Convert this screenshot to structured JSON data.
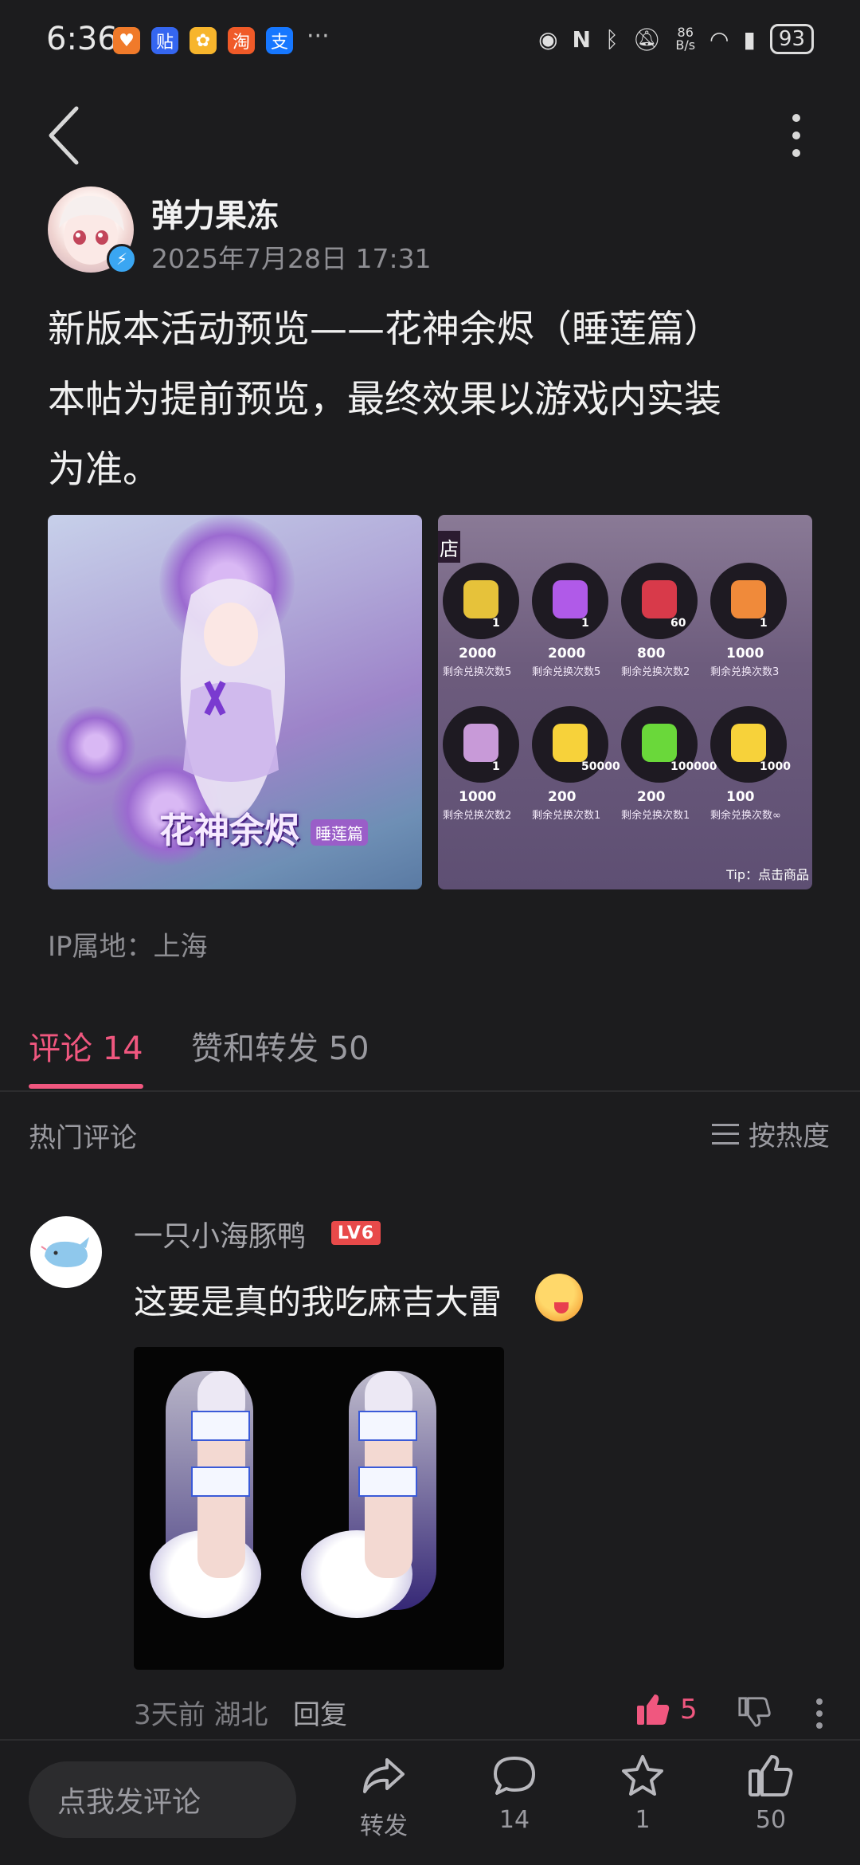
{
  "status_bar": {
    "time": "6:36",
    "apps": [
      {
        "name": "health-app-icon",
        "glyph": "♥",
        "color": "#f07a2a"
      },
      {
        "name": "tieba-app-icon",
        "glyph": "贴",
        "color": "#3566f0"
      },
      {
        "name": "flower-app-icon",
        "glyph": "✿",
        "color": "#f7b52c"
      },
      {
        "name": "taobao-app-icon",
        "glyph": "淘",
        "color": "#f05a28"
      },
      {
        "name": "alipay-app-icon",
        "glyph": "支",
        "color": "#1677ff"
      }
    ],
    "more": "···",
    "net_speed_value": "86",
    "net_speed_unit": "B/s",
    "battery": "93"
  },
  "post": {
    "author": "弹力果冻",
    "time": "2025年7月28日 17:31",
    "content_lines": [
      "新版本活动预览——花神余烬（睡莲篇）",
      "本帖为提前预览，最终效果以游戏内实装",
      "为准。"
    ],
    "banner_title": "花神余烬",
    "banner_subtitle": "睡莲篇",
    "ip_location": "IP属地：上海"
  },
  "shop": {
    "tag": "店",
    "items": [
      {
        "qty": "1",
        "price": "2000",
        "note": "剩余兑换次数5",
        "color": "#e6c23a"
      },
      {
        "qty": "1",
        "price": "2000",
        "note": "剩余兑换次数5",
        "color": "#b05ae8"
      },
      {
        "qty": "60",
        "price": "800",
        "note": "剩余兑换次数2",
        "color": "#d83a4a"
      },
      {
        "qty": "1",
        "price": "1000",
        "note": "剩余兑换次数3",
        "color": "#f08a3a"
      },
      {
        "qty": "1",
        "price": "1000",
        "note": "剩余兑换次数2",
        "color": "#c89ad8"
      },
      {
        "qty": "50000",
        "price": "200",
        "note": "剩余兑换次数1",
        "color": "#f7d23a"
      },
      {
        "qty": "100000",
        "price": "200",
        "note": "剩余兑换次数1",
        "color": "#6ad83a"
      },
      {
        "qty": "1000",
        "price": "100",
        "note": "剩余兑换次数∞",
        "color": "#f7d23a"
      }
    ],
    "tip": "Tip：点击商品"
  },
  "tabs": {
    "comments_label": "评论",
    "comments_count": "14",
    "likes_label": "赞和转发",
    "likes_count": "50"
  },
  "comments_header": {
    "hot_label": "热门评论",
    "sort_label": "按热度"
  },
  "comment": {
    "username": "一只小海豚鸭",
    "level": "LV6",
    "text": "这要是真的我吃麻吉大雷",
    "time": "3天前",
    "location": "湖北",
    "reply_label": "回复",
    "likes": "5"
  },
  "bottom_bar": {
    "input_placeholder": "点我发评论",
    "share_label": "转发",
    "comment_count": "14",
    "favorite_count": "1",
    "like_count": "50"
  }
}
